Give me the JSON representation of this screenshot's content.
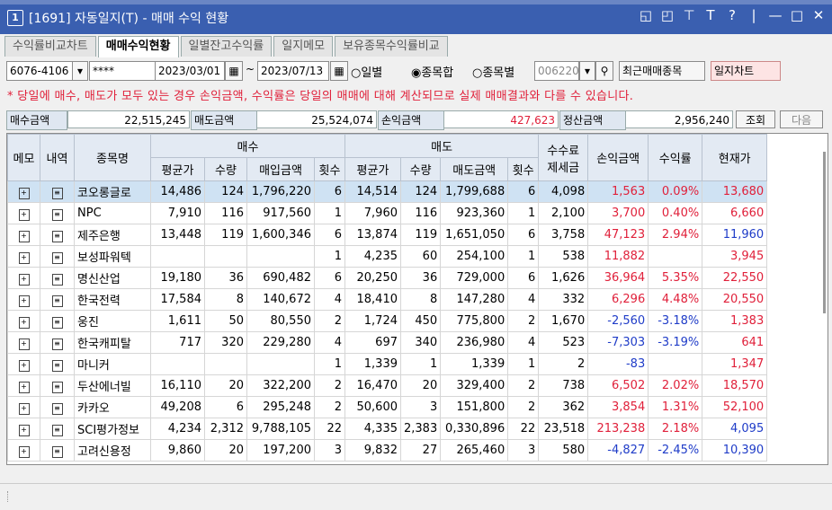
{
  "window": {
    "number": "1",
    "title": "[1691] 자동일지(T) - 매매 수익 현황",
    "controls": [
      "◱",
      "◰",
      "⊤",
      "T",
      "?",
      "|",
      "—",
      "□",
      "✕"
    ]
  },
  "tabs": [
    {
      "label": "수익률비교차트",
      "active": false
    },
    {
      "label": "매매수익현황",
      "active": true
    },
    {
      "label": "일별잔고수익률",
      "active": false
    },
    {
      "label": "일지메모",
      "active": false
    },
    {
      "label": "보유종목수익률비교",
      "active": false
    }
  ],
  "toolbar": {
    "account": "6076-4106",
    "password": "****",
    "date_from": "2023/03/01",
    "date_sep": "~",
    "date_to": "2023/07/13",
    "radio_daily": "일별",
    "radio_total": "종목합",
    "radio_by_stock": "종목별",
    "stock_code": "006220",
    "recent_btn": "최근매매종목",
    "chart_btn": "일지차트"
  },
  "notice": "* 당일에 매수, 매도가 모두 있는 경우 손익금액, 수익률은 당일의 매매에 대해 계산되므로 실제 매매결과와 다를 수 있습니다.",
  "summary": {
    "buy_label": "매수금액",
    "buy_value": "22,515,245",
    "sell_label": "매도금액",
    "sell_value": "25,524,074",
    "pl_label": "손익금액",
    "pl_value": "427,623",
    "settle_label": "정산금액",
    "settle_value": "2,956,240",
    "query_btn": "조회",
    "next_btn": "다음"
  },
  "table": {
    "headers": {
      "memo": "메모",
      "history": "내역",
      "name": "종목명",
      "buy_group": "매수",
      "sell_group": "매도",
      "fee_l1": "수수료",
      "fee_l2": "제세금",
      "pl": "손익금액",
      "rate": "수익률",
      "current": "현재가",
      "avg": "평균가",
      "qty": "수량",
      "buy_amt": "매입금액",
      "cnt": "횟수",
      "sell_amt": "매도금액"
    },
    "rows": [
      {
        "name": "코오롱글로",
        "buy_avg": "14,486",
        "buy_qty": "124",
        "buy_amt": "1,796,220",
        "buy_cnt": "6",
        "sell_avg": "14,514",
        "sell_qty": "124",
        "sell_amt": "1,799,688",
        "sell_cnt": "6",
        "fee": "4,098",
        "pl": "1,563",
        "rate": "0.09%",
        "current": "13,680",
        "pl_color": "r",
        "cur_color": "r",
        "selected": true
      },
      {
        "name": "NPC",
        "buy_avg": "7,910",
        "buy_qty": "116",
        "buy_amt": "917,560",
        "buy_cnt": "1",
        "sell_avg": "7,960",
        "sell_qty": "116",
        "sell_amt": "923,360",
        "sell_cnt": "1",
        "fee": "2,100",
        "pl": "3,700",
        "rate": "0.40%",
        "current": "6,660",
        "pl_color": "r",
        "cur_color": "r"
      },
      {
        "name": "제주은행",
        "buy_avg": "13,448",
        "buy_qty": "119",
        "buy_amt": "1,600,346",
        "buy_cnt": "6",
        "sell_avg": "13,874",
        "sell_qty": "119",
        "sell_amt": "1,651,050",
        "sell_cnt": "6",
        "fee": "3,758",
        "pl": "47,123",
        "rate": "2.94%",
        "current": "11,960",
        "pl_color": "r",
        "cur_color": "b"
      },
      {
        "name": "보성파워텍",
        "buy_avg": "",
        "buy_qty": "",
        "buy_amt": "",
        "buy_cnt": "1",
        "sell_avg": "4,235",
        "sell_qty": "60",
        "sell_amt": "254,100",
        "sell_cnt": "1",
        "fee": "538",
        "pl": "11,882",
        "rate": "",
        "current": "3,945",
        "pl_color": "r",
        "cur_color": "r"
      },
      {
        "name": "명신산업",
        "buy_avg": "19,180",
        "buy_qty": "36",
        "buy_amt": "690,482",
        "buy_cnt": "6",
        "sell_avg": "20,250",
        "sell_qty": "36",
        "sell_amt": "729,000",
        "sell_cnt": "6",
        "fee": "1,626",
        "pl": "36,964",
        "rate": "5.35%",
        "current": "22,550",
        "pl_color": "r",
        "cur_color": "r"
      },
      {
        "name": "한국전력",
        "buy_avg": "17,584",
        "buy_qty": "8",
        "buy_amt": "140,672",
        "buy_cnt": "4",
        "sell_avg": "18,410",
        "sell_qty": "8",
        "sell_amt": "147,280",
        "sell_cnt": "4",
        "fee": "332",
        "pl": "6,296",
        "rate": "4.48%",
        "current": "20,550",
        "pl_color": "r",
        "cur_color": "r"
      },
      {
        "name": "웅진",
        "buy_avg": "1,611",
        "buy_qty": "50",
        "buy_amt": "80,550",
        "buy_cnt": "2",
        "sell_avg": "1,724",
        "sell_qty": "450",
        "sell_amt": "775,800",
        "sell_cnt": "2",
        "fee": "1,670",
        "pl": "-2,560",
        "rate": "-3.18%",
        "current": "1,383",
        "pl_color": "b",
        "cur_color": "r"
      },
      {
        "name": "한국캐피탈",
        "buy_avg": "717",
        "buy_qty": "320",
        "buy_amt": "229,280",
        "buy_cnt": "4",
        "sell_avg": "697",
        "sell_qty": "340",
        "sell_amt": "236,980",
        "sell_cnt": "4",
        "fee": "523",
        "pl": "-7,303",
        "rate": "-3.19%",
        "current": "641",
        "pl_color": "b",
        "cur_color": "r"
      },
      {
        "name": "마니커",
        "buy_avg": "",
        "buy_qty": "",
        "buy_amt": "",
        "buy_cnt": "1",
        "sell_avg": "1,339",
        "sell_qty": "1",
        "sell_amt": "1,339",
        "sell_cnt": "1",
        "fee": "2",
        "pl": "-83",
        "rate": "",
        "current": "1,347",
        "pl_color": "b",
        "cur_color": "r"
      },
      {
        "name": "두산에너빌",
        "buy_avg": "16,110",
        "buy_qty": "20",
        "buy_amt": "322,200",
        "buy_cnt": "2",
        "sell_avg": "16,470",
        "sell_qty": "20",
        "sell_amt": "329,400",
        "sell_cnt": "2",
        "fee": "738",
        "pl": "6,502",
        "rate": "2.02%",
        "current": "18,570",
        "pl_color": "r",
        "cur_color": "r"
      },
      {
        "name": "카카오",
        "buy_avg": "49,208",
        "buy_qty": "6",
        "buy_amt": "295,248",
        "buy_cnt": "2",
        "sell_avg": "50,600",
        "sell_qty": "3",
        "sell_amt": "151,800",
        "sell_cnt": "2",
        "fee": "362",
        "pl": "3,854",
        "rate": "1.31%",
        "current": "52,100",
        "pl_color": "r",
        "cur_color": "r"
      },
      {
        "name": "SCI평가정보",
        "buy_avg": "4,234",
        "buy_qty": "2,312",
        "buy_amt": "9,788,105",
        "buy_cnt": "22",
        "sell_avg": "4,335",
        "sell_qty": "2,383",
        "sell_amt": "0,330,896",
        "sell_cnt": "22",
        "fee": "23,518",
        "pl": "213,238",
        "rate": "2.18%",
        "current": "4,095",
        "pl_color": "r",
        "cur_color": "b"
      },
      {
        "name": "고려신용정",
        "buy_avg": "9,860",
        "buy_qty": "20",
        "buy_amt": "197,200",
        "buy_cnt": "3",
        "sell_avg": "9,832",
        "sell_qty": "27",
        "sell_amt": "265,460",
        "sell_cnt": "3",
        "fee": "580",
        "pl": "-4,827",
        "rate": "-2.45%",
        "current": "10,390",
        "pl_color": "b",
        "cur_color": "b"
      }
    ]
  },
  "colors": {
    "positive": "#e0203a",
    "negative": "#1f3cc8",
    "selected_row": "#cfe2f3",
    "titlebar": "#3a5fb0"
  }
}
